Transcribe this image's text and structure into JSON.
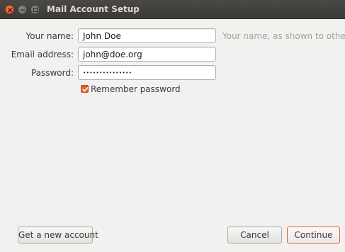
{
  "window": {
    "title": "Mail Account Setup"
  },
  "form": {
    "name_label": "Your name:",
    "name_value": "John Doe",
    "name_hint": "Your name, as shown to others",
    "email_label": "Email address:",
    "email_value": "john@doe.org",
    "password_label": "Password:",
    "password_value": "•••••••••••••••",
    "remember_label": "Remember password",
    "remember_checked": true
  },
  "buttons": {
    "new_account": "Get a new account",
    "cancel": "Cancel",
    "continue": "Continue"
  },
  "colors": {
    "accent": "#e0612f",
    "titlebar": "#3c3b37",
    "window_bg": "#f2f1f0"
  }
}
